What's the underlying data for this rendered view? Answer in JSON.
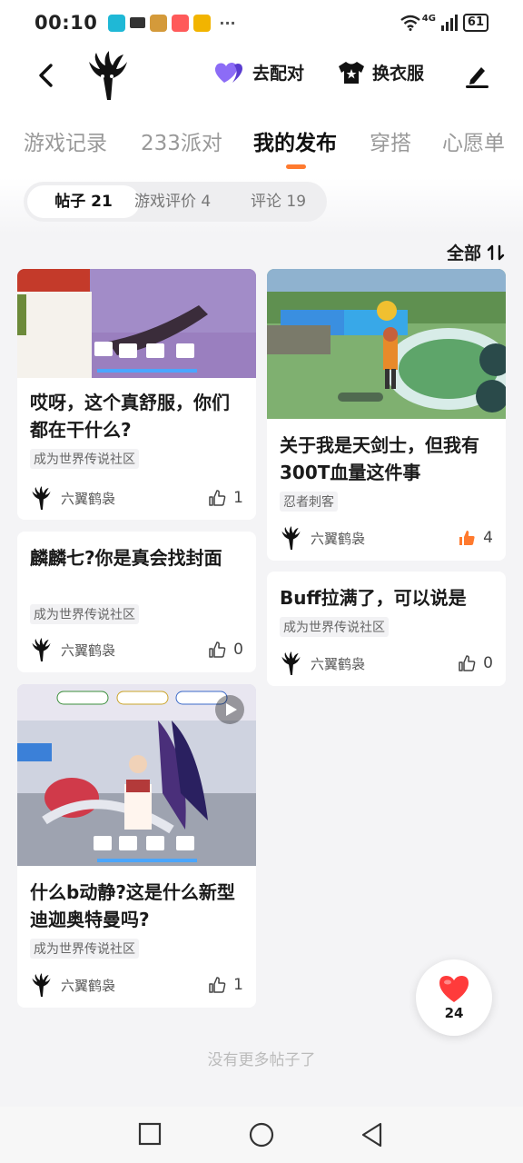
{
  "status_bar": {
    "time": "00:10",
    "more": "···",
    "network": "4G",
    "battery": "61"
  },
  "header": {
    "match_label": "去配对",
    "dress_label": "换衣服"
  },
  "tabs": [
    "游戏记录",
    "233派对",
    "我的发布",
    "穿搭",
    "心愿单"
  ],
  "filters": [
    "帖子 21",
    "游戏评价 4",
    "评论 19"
  ],
  "sort_label": "全部",
  "posts": [
    {
      "title": "哎呀，这个真舒服，你们都在干什么?",
      "tag": "成为世界传说社区",
      "author": "六翼鹤袅",
      "likes": "1"
    },
    {
      "title": "麟麟七?你是真会找封面",
      "tag": "成为世界传说社区",
      "author": "六翼鹤袅",
      "likes": "0"
    },
    {
      "title": "什么b动静?这是什么新型迪迦奥特曼吗?",
      "tag": "成为世界传说社区",
      "author": "六翼鹤袅",
      "likes": "1"
    },
    {
      "title": "关于我是天剑士，但我有300T血量这件事",
      "tag": "忍者刺客",
      "author": "六翼鹤袅",
      "likes": "4"
    },
    {
      "title": "Buff拉满了，可以说是",
      "tag": "成为世界传说社区",
      "author": "六翼鹤袅",
      "likes": "0"
    }
  ],
  "fab": {
    "count": "24"
  },
  "footer_text": "没有更多帖子了",
  "colors": {
    "accent": "#ff7a2e",
    "match_heart": "#7b5cf0",
    "liked": "#ff7a2e",
    "fab_heart": "#ff3b3b"
  }
}
